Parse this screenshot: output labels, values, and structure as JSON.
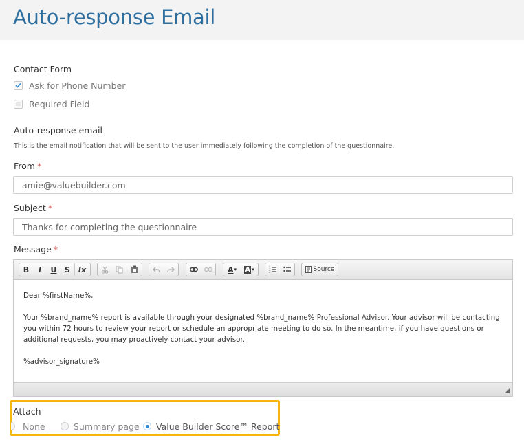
{
  "header": {
    "title": "Auto-response Email"
  },
  "contact_form": {
    "title": "Contact Form",
    "options": [
      {
        "label": "Ask for Phone Number",
        "checked": true
      },
      {
        "label": "Required Field",
        "checked": false
      }
    ]
  },
  "auto_response": {
    "title": "Auto-response email",
    "hint": "This is the email notification that will be sent to the user immediately following the completion of the questionnaire."
  },
  "from": {
    "label": "From",
    "required": "*",
    "value": "amie@valuebuilder.com"
  },
  "subject": {
    "label": "Subject",
    "required": "*",
    "value": "Thanks for completing the questionnaire"
  },
  "message": {
    "label": "Message",
    "required": "*",
    "toolbar": {
      "bold": "B",
      "italic": "I",
      "underline": "U",
      "strike": "S",
      "remove_format": "Ix",
      "text_color": "A",
      "bg_color": "A",
      "source": "Source"
    },
    "body": {
      "greeting": "Dear %firstName%,",
      "paragraph": "Your %brand_name% report is available through your designated %brand_name% Professional Advisor. Your advisor will be contacting you within 72 hours to review your report or schedule an appropriate meeting to do so. In the meantime, if you have questions or additional requests, you may proactively contact your advisor.",
      "signature": "%advisor_signature%"
    }
  },
  "attach": {
    "title": "Attach",
    "options": [
      {
        "label": "None",
        "selected": false
      },
      {
        "label": "Summary page",
        "selected": false
      },
      {
        "label": "Value Builder Score™ Report",
        "selected": true
      }
    ]
  },
  "colors": {
    "title_blue": "#2f6f9f",
    "required_red": "#d9534f",
    "highlight": "#f5b50d",
    "radio_blue": "#2d8ad6"
  }
}
